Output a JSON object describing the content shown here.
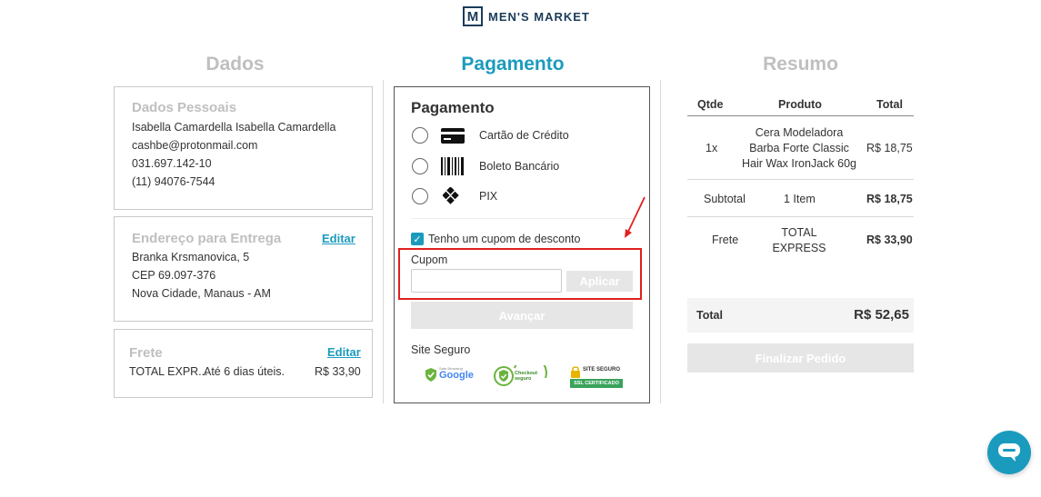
{
  "brand": {
    "logo_letter": "M",
    "name": "MEN'S MARKET"
  },
  "columns": {
    "dados": "Dados",
    "pagamento": "Pagamento",
    "resumo": "Resumo"
  },
  "personal": {
    "title": "Dados Pessoais",
    "name": "Isabella Camardella Isabella Camardella",
    "email": "cashbe@protonmail.com",
    "cpf": "031.697.142-10",
    "phone": "(11) 94076-7544"
  },
  "address": {
    "title": "Endereço para Entrega",
    "edit_label": "Editar",
    "street": "Branka Krsmanovica, 5",
    "cep": "CEP 69.097-376",
    "city": "Nova Cidade, Manaus - AM"
  },
  "shipping": {
    "title": "Frete",
    "edit_label": "Editar",
    "method": "TOTAL EXPR...",
    "eta": "Até 6 dias úteis.",
    "price": "R$ 33,90"
  },
  "payment": {
    "title": "Pagamento",
    "options": [
      {
        "label": "Cartão de Crédito",
        "icon": "credit-card-icon"
      },
      {
        "label": "Boleto Bancário",
        "icon": "barcode-icon"
      },
      {
        "label": "PIX",
        "icon": "pix-icon"
      }
    ],
    "coupon_checkbox_label": "Tenho um cupom de desconto",
    "coupon_label": "Cupom",
    "coupon_value": "",
    "apply_label": "Aplicar",
    "next_label": "Avançar",
    "secure_label": "Site Seguro",
    "badges": {
      "google": "Google",
      "google_small": "Safe Browsing",
      "checkout": "Checkout seguro",
      "ssl_top": "SITE SEGURO",
      "ssl_bottom": "SSL CERTIFICADO"
    }
  },
  "summary": {
    "headers": {
      "qty": "Qtde",
      "product": "Produto",
      "total": "Total"
    },
    "items": [
      {
        "qty": "1x",
        "product": "Cera Modeladora Barba Forte Classic Hair Wax IronJack 60g",
        "total": "R$ 18,75"
      }
    ],
    "subtotal": {
      "label": "Subtotal",
      "mid": "1 Item",
      "value": "R$ 18,75"
    },
    "frete": {
      "label": "Frete",
      "mid": "TOTAL EXPRESS",
      "value": "R$ 33,90"
    },
    "total": {
      "label": "Total",
      "value": "R$ 52,65"
    },
    "finish_label": "Finalizar Pedido"
  },
  "colors": {
    "accent": "#1a9bbd",
    "annotation": "#e02020",
    "disabled": "#e6e6e6"
  }
}
